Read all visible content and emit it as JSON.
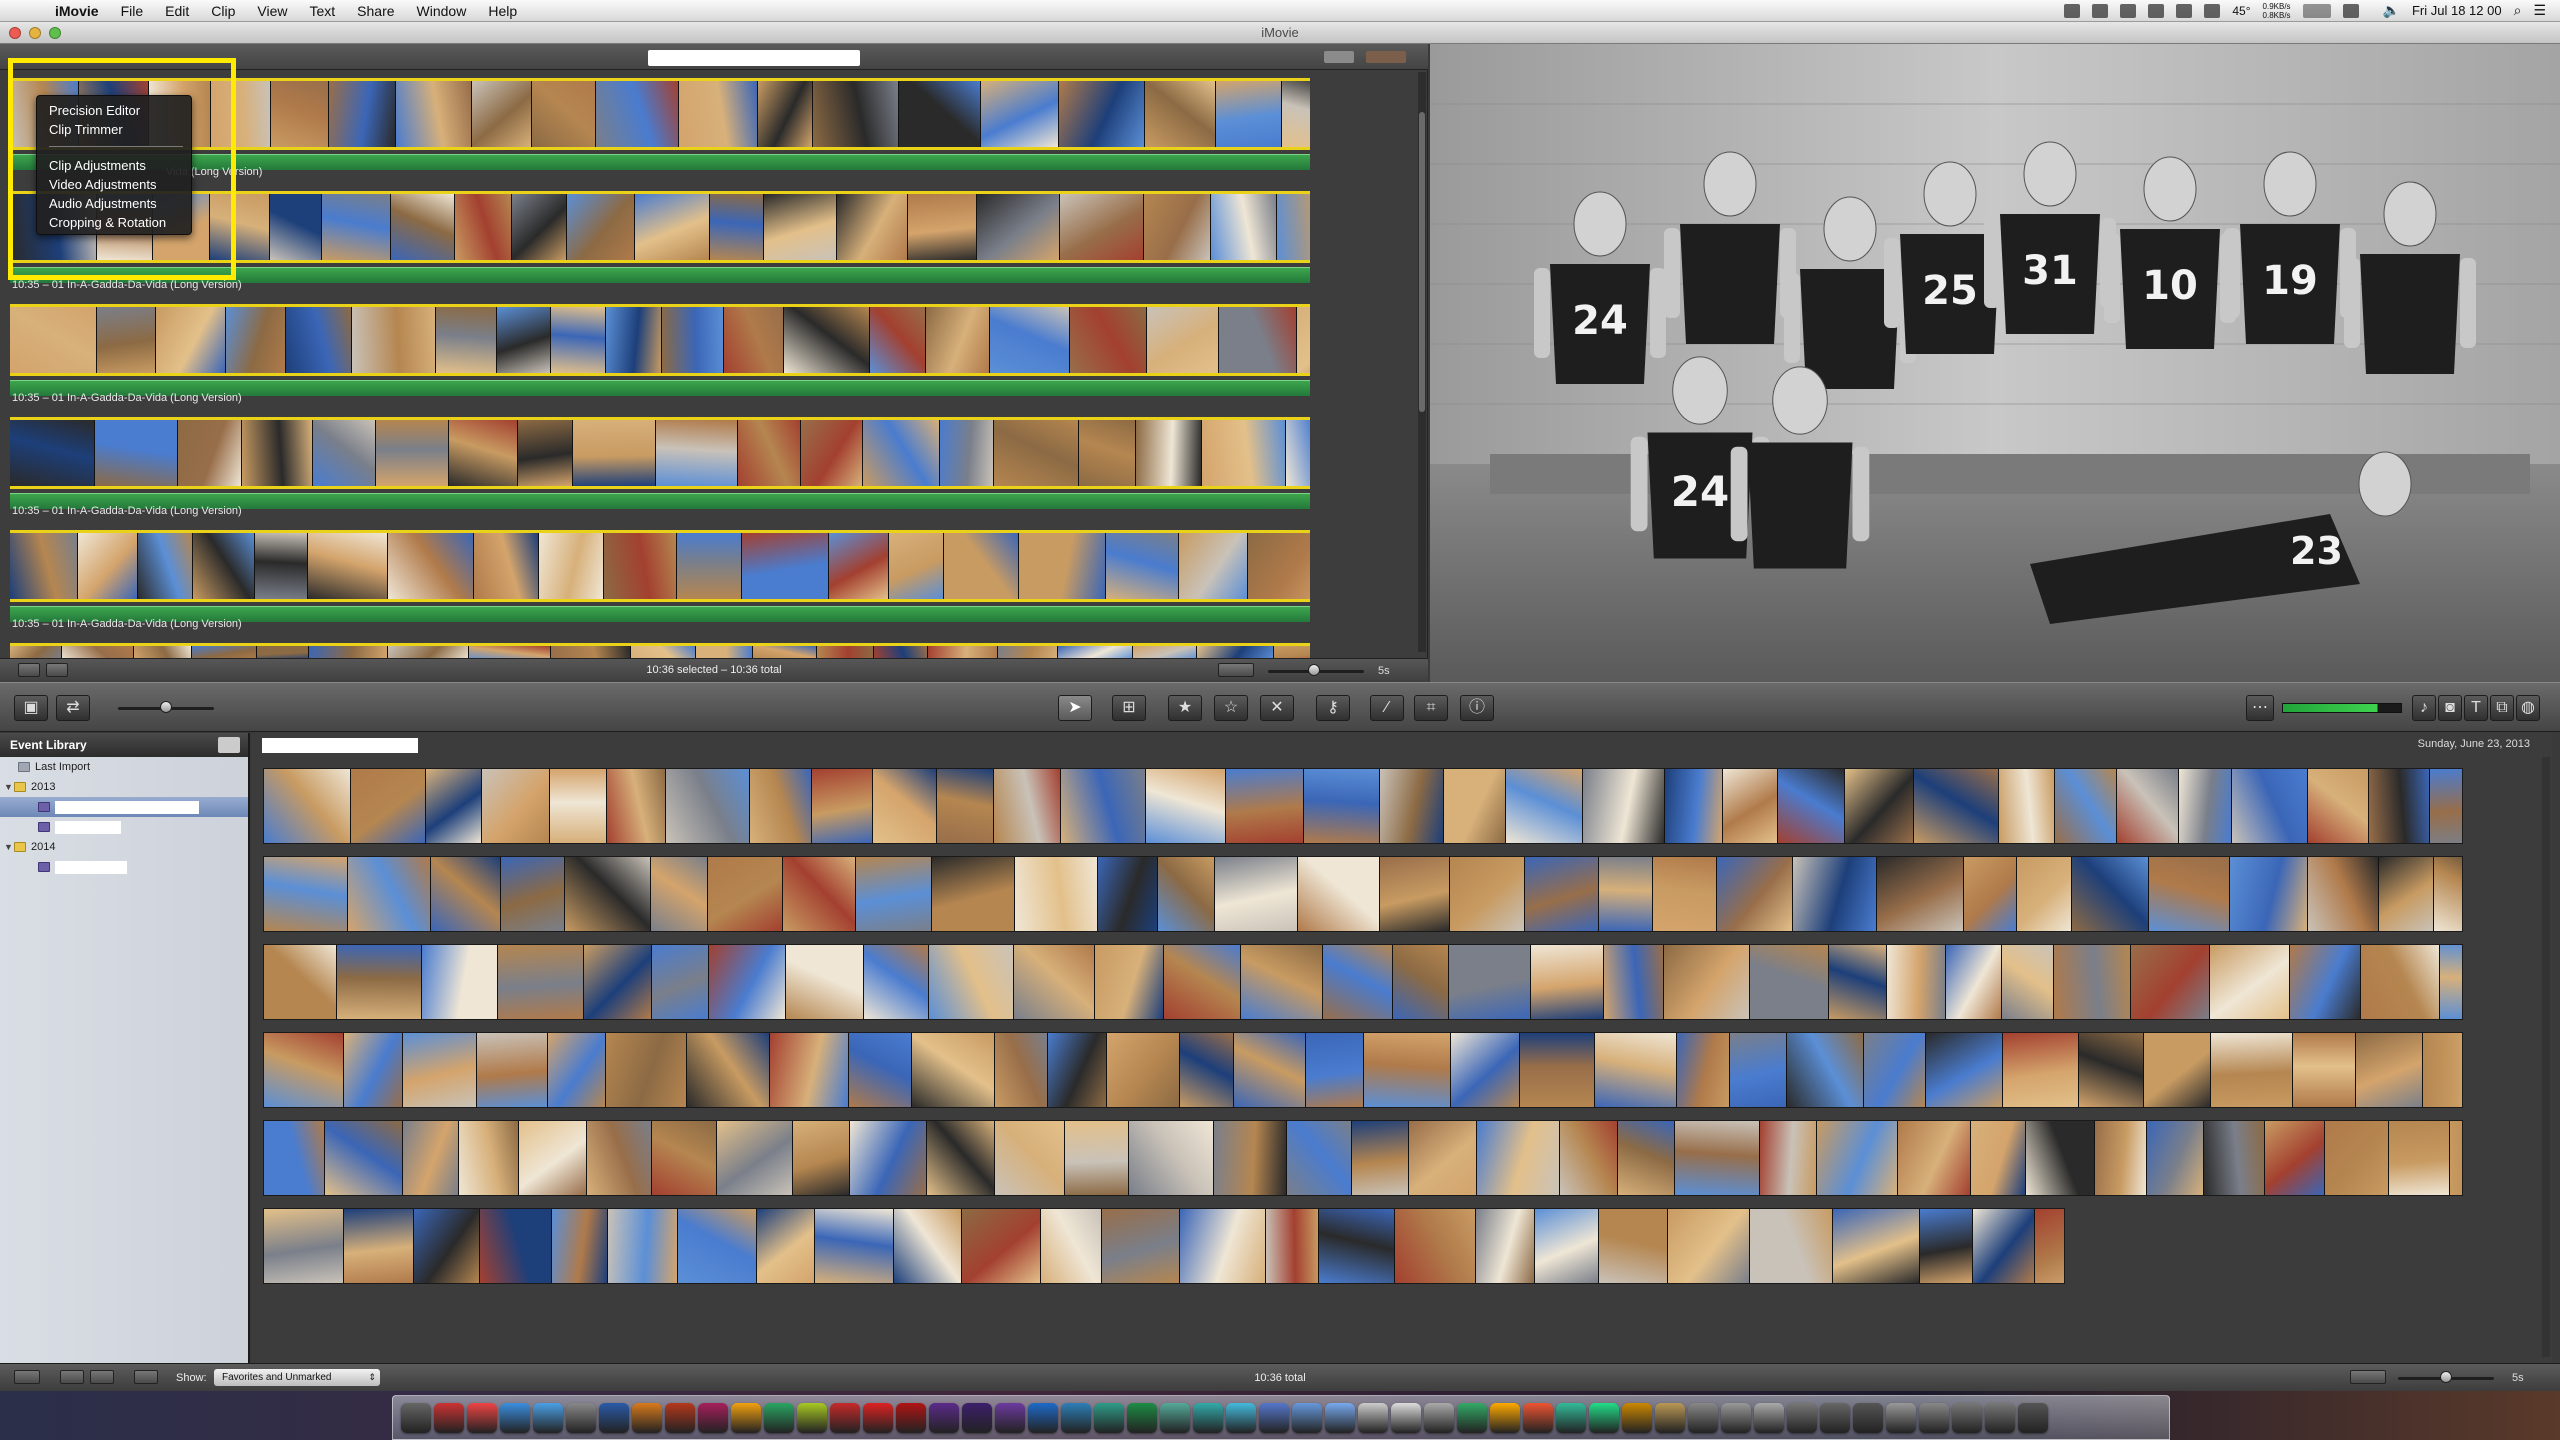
{
  "menubar": {
    "app_name": "iMovie",
    "menus": [
      "File",
      "Edit",
      "Clip",
      "View",
      "Text",
      "Share",
      "Window",
      "Help"
    ],
    "temperature": "45°",
    "net_up": "0.9KB/s",
    "net_down": "0.8KB/s",
    "clock": "Fri Jul 18  12 00"
  },
  "window": {
    "title": "iMovie"
  },
  "context_menu": {
    "items": [
      "Precision Editor",
      "Clip Trimmer",
      "Clip Adjustments",
      "Video Adjustments",
      "Audio Adjustments",
      "Cropping & Rotation"
    ]
  },
  "project": {
    "music_rows": [
      {
        "label": "10:35 – 01 In-A-Gadda-Da-Vida (Long Version)",
        "partial_label": "Vida (Long Version)"
      },
      {
        "label": "10:35 – 01 In-A-Gadda-Da-Vida (Long Version)"
      },
      {
        "label": "10:35 – 01 In-A-Gadda-Da-Vida (Long Version)"
      },
      {
        "label": "10:35 – 01 In-A-Gadda-Da-Vida (Long Version)"
      },
      {
        "label": "10:35 – 01 In-A-Gadda-Da-Vida (Long Version)"
      }
    ],
    "status": "10:36 selected – 10:36 total",
    "zoom_label": "5s"
  },
  "viewer": {
    "jersey_numbers": [
      "24",
      "25",
      "31",
      "10",
      "19",
      "24",
      "23"
    ]
  },
  "event_library": {
    "header": "Event Library",
    "last_import": "Last Import",
    "years": [
      "2013",
      "2014"
    ]
  },
  "event_browser": {
    "date": "Sunday, June 23, 2013"
  },
  "bottom_bar": {
    "show_label": "Show:",
    "show_value": "Favorites and Unmarked",
    "total": "10:36 total",
    "zoom_label": "5s"
  },
  "colors": {
    "highlight": "#ffea00",
    "music_bar": "#2e8b44",
    "selection_yellow": "#ead219"
  },
  "icons": [
    "apple-icon",
    "wifi-icon",
    "volume-icon",
    "search-icon",
    "pointer-icon",
    "star-icon",
    "reject-icon",
    "crop-icon",
    "info-icon",
    "eyedropper-icon"
  ]
}
